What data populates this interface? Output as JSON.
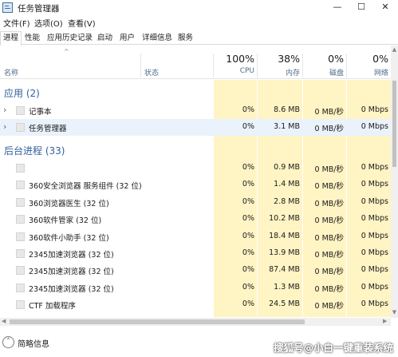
{
  "window": {
    "title": "任务管理器",
    "min_glyph": "—",
    "max_glyph": "☐",
    "close_glyph": "✕"
  },
  "menu": [
    "文件(F)",
    "选项(O)",
    "查看(V)"
  ],
  "tabs": [
    "进程",
    "性能",
    "应用历史记录",
    "启动",
    "用户",
    "详细信息",
    "服务"
  ],
  "header": {
    "name_label": "名称",
    "status_label": "状态",
    "cpu_pct": "100%",
    "cpu_label": "CPU",
    "mem_pct": "38%",
    "mem_label": "内存",
    "disk_pct": "0%",
    "disk_label": "磁盘",
    "net_pct": "0%",
    "net_label": "网络"
  },
  "groups": {
    "apps": "应用 (2)",
    "background": "后台进程 (33)"
  },
  "apps": [
    {
      "name": "记事本",
      "cpu": "0%",
      "mem": "8.6 MB",
      "disk": "0 MB/秒",
      "net": "0 Mbps"
    },
    {
      "name": "任务管理器",
      "cpu": "0%",
      "mem": "3.1 MB",
      "disk": "0 MB/秒",
      "net": "0 Mbps"
    }
  ],
  "background": [
    {
      "name": "",
      "cpu": "0%",
      "mem": "0.9 MB",
      "disk": "0 MB/秒",
      "net": "0 Mbps"
    },
    {
      "name": "360安全浏览器 服务组件 (32 位)",
      "cpu": "0%",
      "mem": "1.4 MB",
      "disk": "0 MB/秒",
      "net": "0 Mbps"
    },
    {
      "name": "360浏览器医生 (32 位)",
      "cpu": "0%",
      "mem": "2.8 MB",
      "disk": "0 MB/秒",
      "net": "0 Mbps"
    },
    {
      "name": "360软件管家 (32 位)",
      "cpu": "0%",
      "mem": "10.2 MB",
      "disk": "0 MB/秒",
      "net": "0 Mbps"
    },
    {
      "name": "360软件小助手 (32 位)",
      "cpu": "0%",
      "mem": "18.4 MB",
      "disk": "0 MB/秒",
      "net": "0 Mbps"
    },
    {
      "name": "2345加速浏览器 (32 位)",
      "cpu": "0%",
      "mem": "13.9 MB",
      "disk": "0 MB/秒",
      "net": "0 Mbps"
    },
    {
      "name": "2345加速浏览器 (32 位)",
      "cpu": "0%",
      "mem": "87.4 MB",
      "disk": "0 MB/秒",
      "net": "0 Mbps"
    },
    {
      "name": "2345加速浏览器 (32 位)",
      "cpu": "0%",
      "mem": "1.3 MB",
      "disk": "0 MB/秒",
      "net": "0 Mbps"
    },
    {
      "name": "CTF 加载程序",
      "cpu": "0%",
      "mem": "24.5 MB",
      "disk": "0 MB/秒",
      "net": "0 Mbps"
    }
  ],
  "footer": {
    "brief_label": "简略信息"
  },
  "watermark": "搜狐号@小白一键重装系统",
  "colors": {
    "group_heading": "#2f5f9b",
    "resource_highlight": "#fff4c4",
    "selected_row": "#eaf2fb"
  }
}
